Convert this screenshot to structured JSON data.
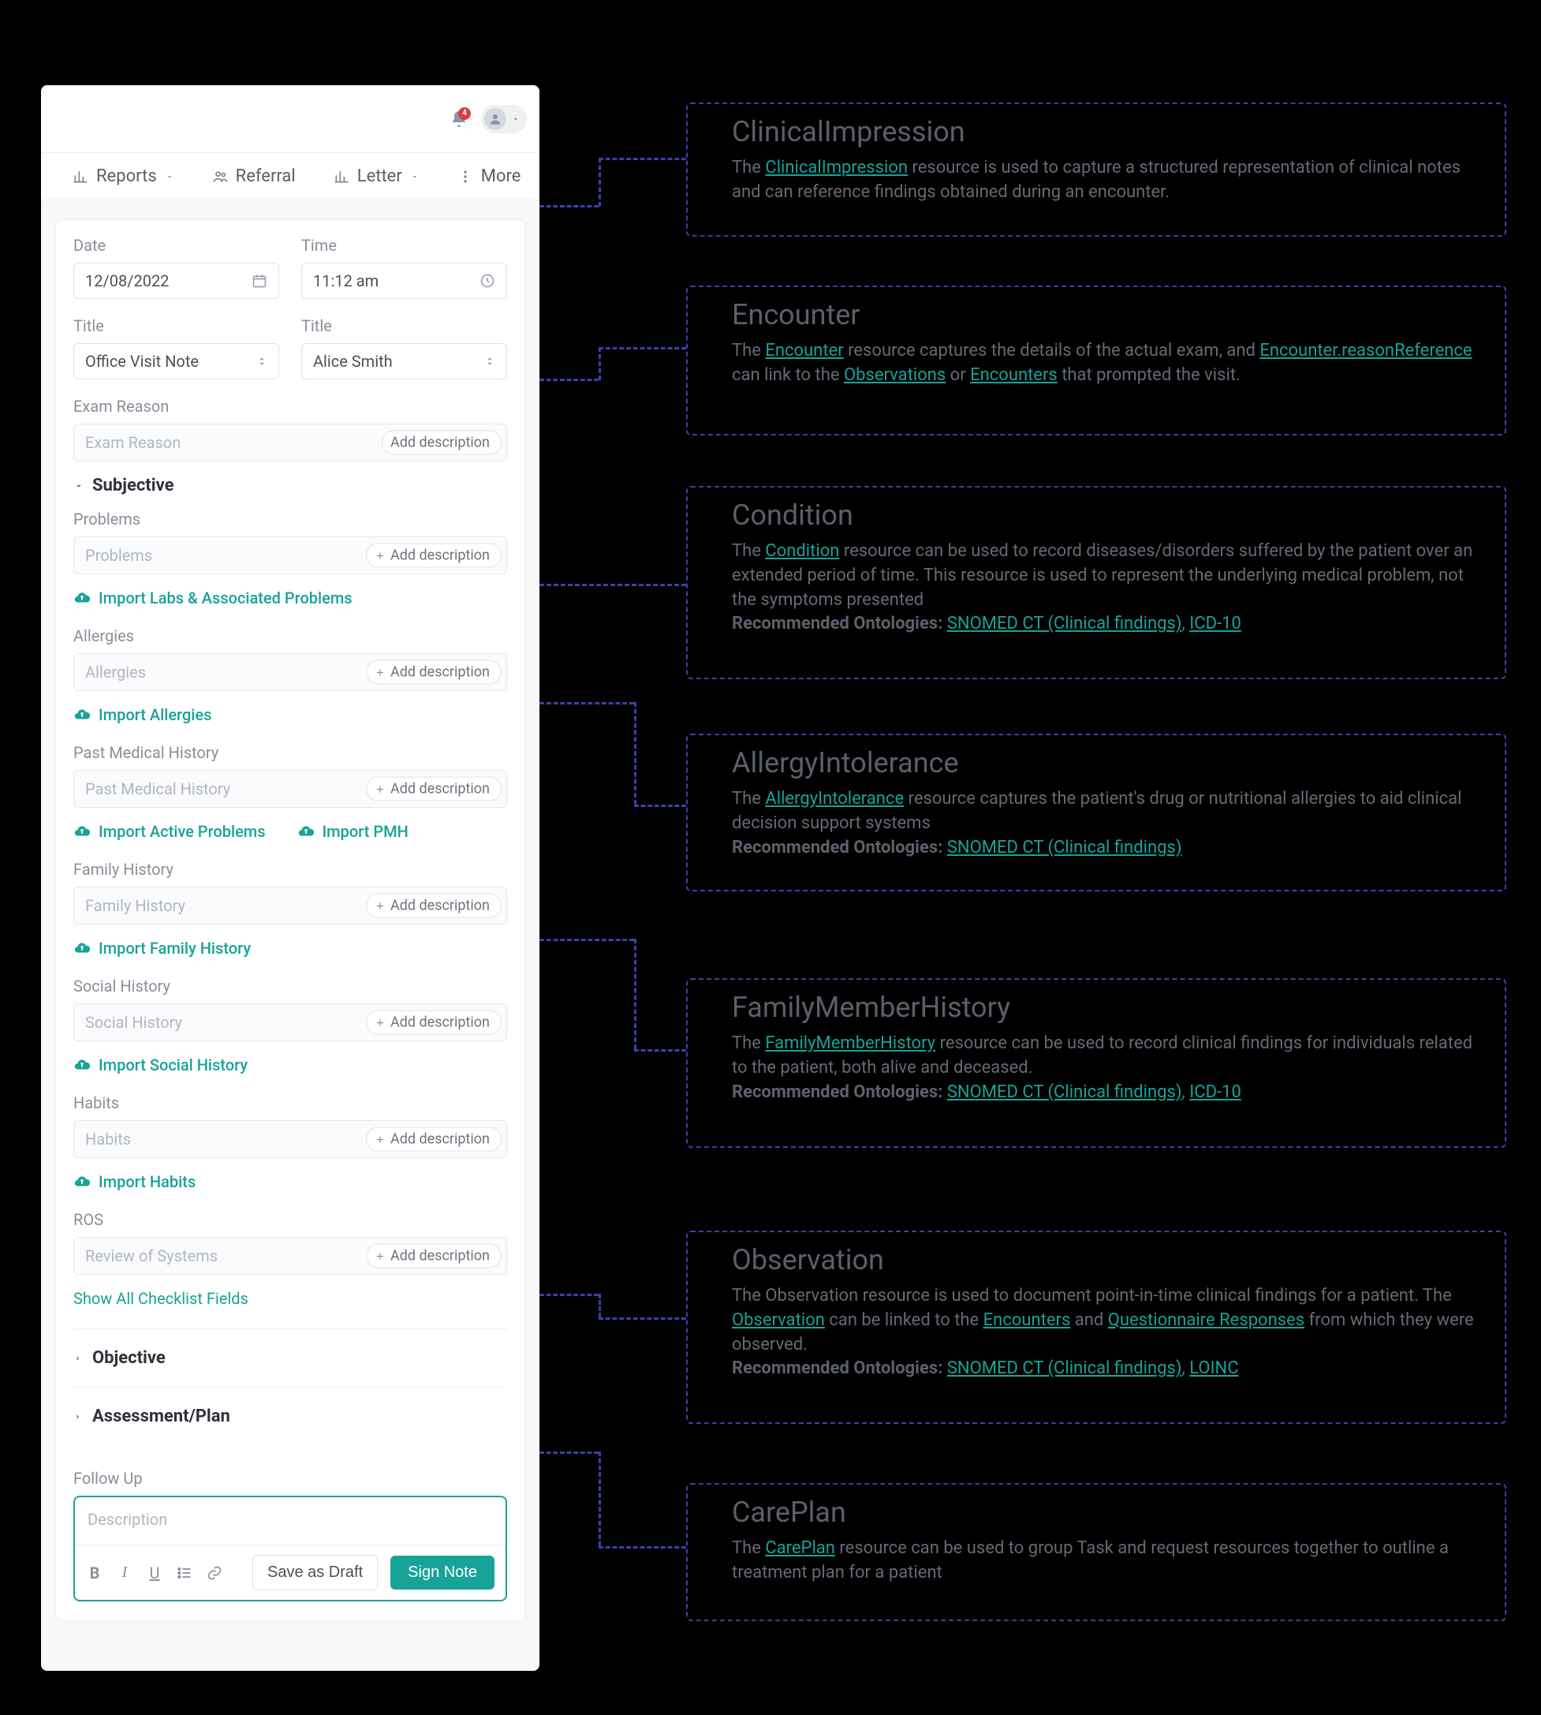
{
  "header": {
    "notif_count": "4"
  },
  "tabs": {
    "reports": "Reports",
    "referral": "Referral",
    "letter": "Letter",
    "more": "More"
  },
  "form": {
    "date_label": "Date",
    "time_label": "Time",
    "date_value": "12/08/2022",
    "time_value": "11:12 am",
    "title1_label": "Title",
    "title2_label": "Title",
    "title1_value": "Office Visit Note",
    "title2_value": "Alice Smith",
    "exam_reason_label": "Exam Reason",
    "exam_reason_placeholder": "Exam Reason",
    "add_description": "Add description"
  },
  "sections": {
    "subjective": "Subjective",
    "objective": "Objective",
    "assessment_plan": "Assessment/Plan",
    "problems_label": "Problems",
    "problems_placeholder": "Problems",
    "import_labs": "Import Labs & Associated Problems",
    "allergies_label": "Allergies",
    "allergies_placeholder": "Allergies",
    "import_allergies": "Import Allergies",
    "pmh_label": "Past Medical History",
    "pmh_placeholder": "Past Medical History",
    "import_active_problems": "Import Active Problems",
    "import_pmh": "Import PMH",
    "family_history_label": "Family History",
    "family_history_placeholder": "Family History",
    "import_family_history": "Import Family History",
    "social_history_label": "Social History",
    "social_history_placeholder": "Social History",
    "import_social_history": "Import Social History",
    "habits_label": "Habits",
    "habits_placeholder": "Habits",
    "import_habits": "Import Habits",
    "ros_label": "ROS",
    "ros_placeholder": "Review of Systems",
    "show_all": "Show All Checklist Fields",
    "follow_up_label": "Follow Up",
    "description_placeholder": "Description",
    "save_draft": "Save as Draft",
    "sign_note": "Sign Note"
  },
  "cards": [
    {
      "title": "ClinicalImpression",
      "body_pre": "The ",
      "link1": "ClinicalImpression",
      "body_post": " resource is used to capture a structured representation of clinical notes and can reference findings obtained during an encounter."
    },
    {
      "title": "Encounter",
      "t1": "The ",
      "a1": "Encounter",
      "t2": " resource captures the details of the actual exam, and ",
      "a2": "Encounter.reasonReference",
      "t3": " can link to the ",
      "a3": "Observations",
      "t4": " or ",
      "a4": "Encounters",
      "t5": " that prompted the visit."
    },
    {
      "title": "Condition",
      "t1": "The ",
      "a1": "Condition",
      "t2": " resource can be used to record diseases/disorders suffered by the patient over an extended period of time. This resource is used to represent the underlying medical problem, not the symptoms presented",
      "rec_label": "Recommended Ontologies: ",
      "rec1": "SNOMED CT (Clinical findings)",
      "sep": ", ",
      "rec2": "ICD-10"
    },
    {
      "title": "AllergyIntolerance",
      "t1": "The ",
      "a1": "AllergyIntolerance",
      "t2": " resource captures the patient's drug or nutritional allergies to aid clinical decision support systems",
      "rec_label": "Recommended Ontologies: ",
      "rec1": "SNOMED CT (Clinical findings)"
    },
    {
      "title": "FamilyMemberHistory",
      "t1": "The ",
      "a1": "FamilyMemberHistory",
      "t2": " resource can be used to record clinical findings for individuals related to the patient, both alive and deceased.",
      "rec_label": "Recommended Ontologies: ",
      "rec1": "SNOMED CT (Clinical findings)",
      "sep": ", ",
      "rec2": "ICD-10"
    },
    {
      "title": "Observation",
      "t1": "The Observation resource is used to document point-in-time clinical findings for a patient. The ",
      "a1": "Observation",
      "t2": " can be linked to the ",
      "a2": "Encounters",
      "t3": " and ",
      "a3": "Questionnaire Responses",
      "t4": " from which they were observed.",
      "rec_label": "Recommended Ontologies: ",
      "rec1": "SNOMED CT (Clinical findings)",
      "sep": ", ",
      "rec2": "LOINC"
    },
    {
      "title": "CarePlan",
      "t1": "The ",
      "a1": "CarePlan",
      "t2": " resource can be used to group Task and request resources together to outline a treatment plan for a patient"
    }
  ]
}
